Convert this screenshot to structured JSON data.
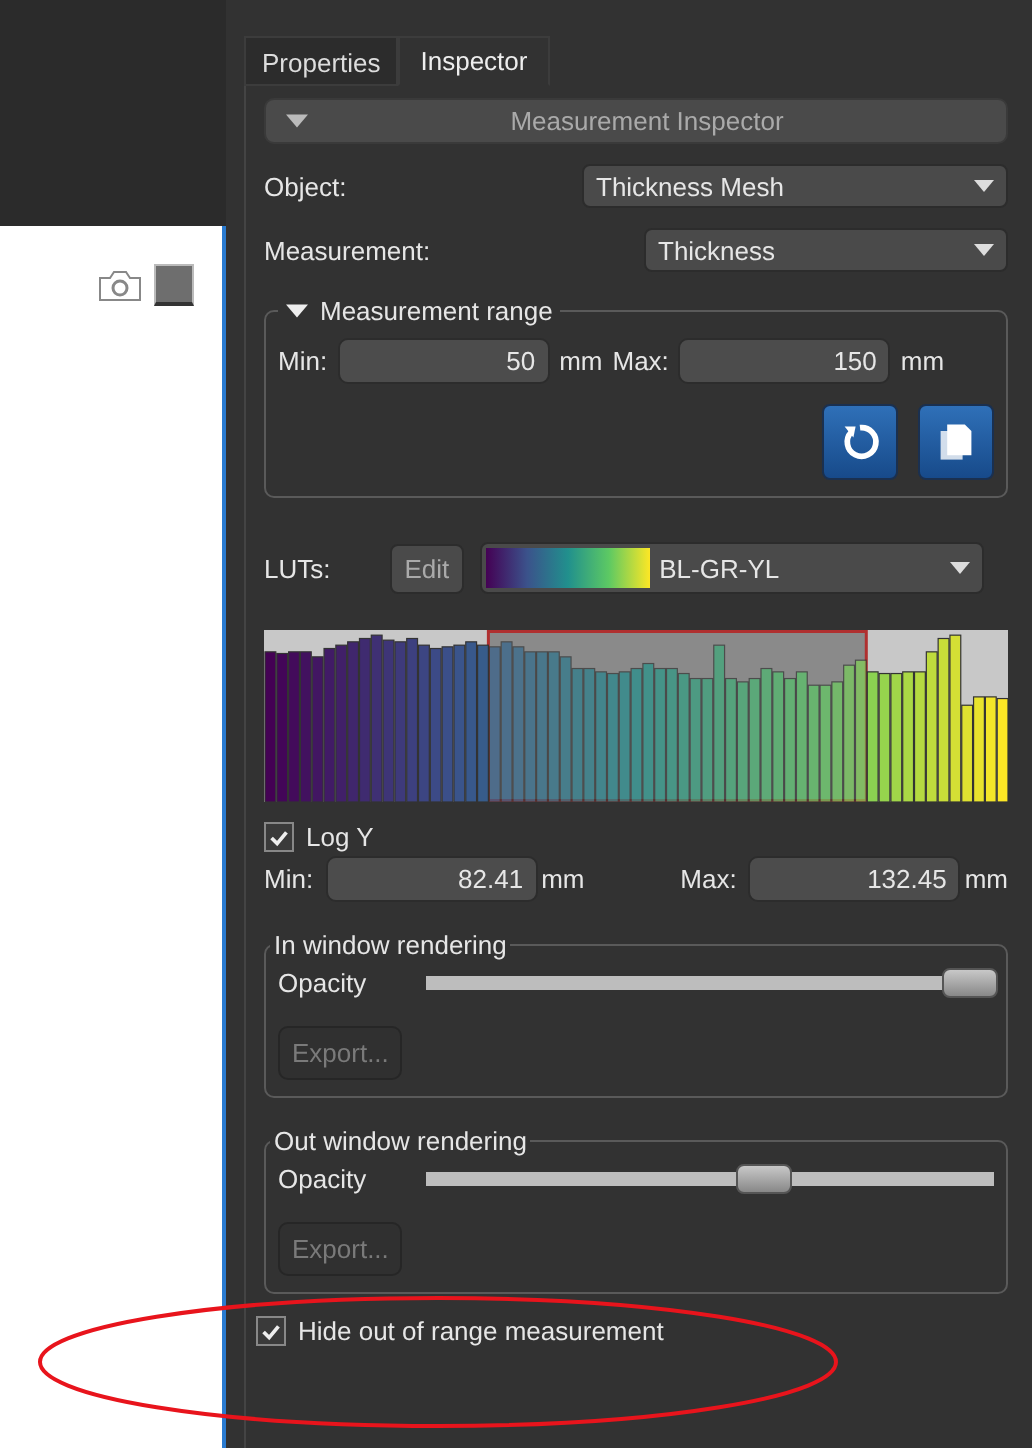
{
  "tabs": [
    {
      "label": "Properties",
      "selected": false
    },
    {
      "label": "Inspector",
      "selected": true
    }
  ],
  "section_header": {
    "label": "Measurement Inspector",
    "expanded": true
  },
  "object": {
    "label": "Object:",
    "value": "Thickness Mesh"
  },
  "measurement": {
    "label": "Measurement:",
    "value": "Thickness"
  },
  "measurement_range": {
    "title": "Measurement range",
    "expanded": true,
    "min_label": "Min:",
    "min_value": "50",
    "min_unit": "mm",
    "max_label": "Max:",
    "max_value": "150",
    "max_unit": "mm"
  },
  "luts": {
    "label": "LUTs:",
    "edit_button": "Edit",
    "value": "BL-GR-YL"
  },
  "histogram": {
    "log_y": {
      "label": "Log Y",
      "checked": true
    },
    "min_label": "Min:",
    "min_value": "82.41",
    "min_unit": "mm",
    "max_label": "Max:",
    "max_value": "132.45",
    "max_unit": "mm"
  },
  "in_window_rendering": {
    "title": "In window rendering",
    "opacity_label": "Opacity",
    "level": 1.0,
    "export_button": "Export...",
    "export_disabled": true
  },
  "out_window_rendering": {
    "title": "Out window rendering",
    "opacity_label": "Opacity",
    "level": 0.6,
    "export_button": "Export...",
    "export_disabled": true
  },
  "hide_out_of_range": {
    "label": "Hide out of range measurement",
    "checked": true
  }
}
